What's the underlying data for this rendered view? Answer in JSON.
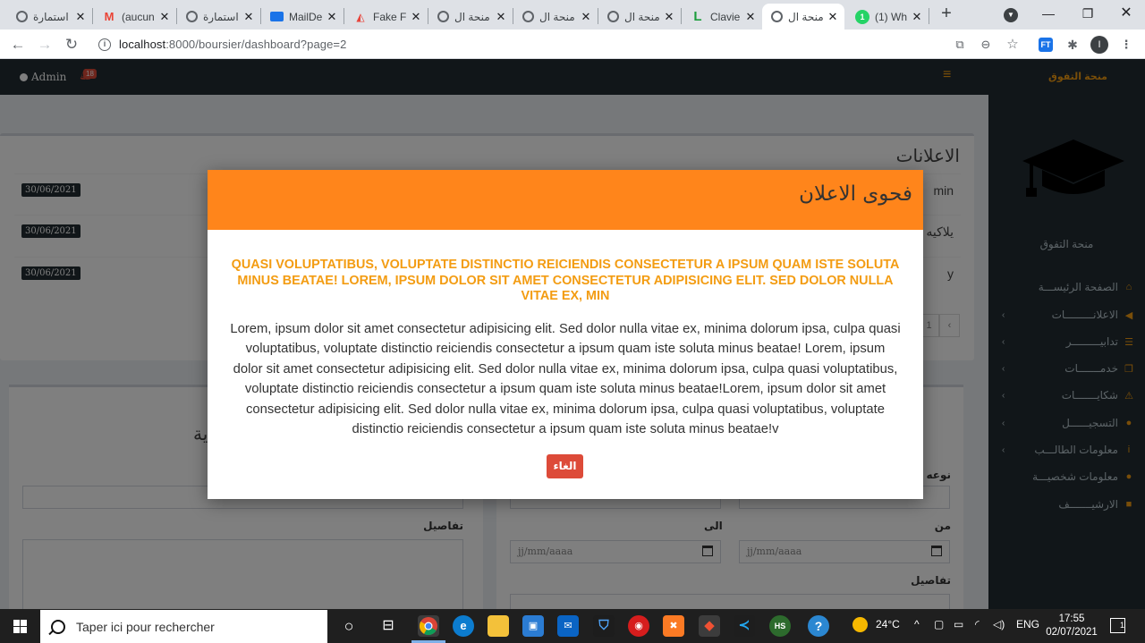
{
  "browser": {
    "tabs": [
      {
        "title": "استمارة",
        "favicon": "globe-icon"
      },
      {
        "title": "(aucun",
        "favicon": "gmail-icon"
      },
      {
        "title": "استمارة",
        "favicon": "globe-icon"
      },
      {
        "title": "MailDe",
        "favicon": "mail-icon"
      },
      {
        "title": "Fake Fi",
        "favicon": "fake-filler-icon"
      },
      {
        "title": "منحة ال",
        "favicon": "globe-icon"
      },
      {
        "title": "منحة ال",
        "favicon": "globe-icon"
      },
      {
        "title": "منحة ال",
        "favicon": "globe-icon"
      },
      {
        "title": "Clavier",
        "favicon": "l-icon"
      },
      {
        "title": "منحة ال",
        "favicon": "globe-icon"
      },
      {
        "title": "(1) Wh",
        "favicon": "whatsapp-icon"
      }
    ],
    "url_host": "localhost",
    "url_path": ":8000/boursier/dashboard?page=2",
    "profile_initial": "I",
    "extension_label": "FT"
  },
  "topnav": {
    "admin_label": "Admin",
    "notification_count": "18"
  },
  "sidebar": {
    "logo_text": "منحة التفوق",
    "brand": "منحة التفوق",
    "items": [
      {
        "label": "الصفحة الرئيســـة"
      },
      {
        "label": "الاعلانـــــــــات"
      },
      {
        "label": "تدابيـــــــــر"
      },
      {
        "label": "خدمـــــــات"
      },
      {
        "label": "شكايـــــــات"
      },
      {
        "label": "التسجيــــــل"
      },
      {
        "label": "معلومات الطالـــب"
      },
      {
        "label": "معلومات شخصيـــة"
      },
      {
        "label": "الارشيـــــــف"
      }
    ]
  },
  "announcements": {
    "title": "الاعلانات",
    "rows": [
      {
        "date": "30/06/2021",
        "text": "min"
      },
      {
        "date": "30/06/2021",
        "text": "يلاكيه"
      },
      {
        "date": "30/06/2021",
        "text": "y"
      }
    ],
    "pager": [
      "1",
      "‹"
    ]
  },
  "form_left": {
    "title": "ية",
    "details_label": "تفاصيل"
  },
  "form_right": {
    "type_label": "نوعه",
    "to_label": "الى",
    "from_label": "من",
    "date_placeholder": "jj/mm/aaaa",
    "details_label": "تفاصيل"
  },
  "modal": {
    "title": "فحوى الاعلان",
    "subtitle": "QUASI VOLUPTATIBUS, VOLUPTATE DISTINCTIO REICIENDIS CONSECTETUR A IPSUM QUAM ISTE SOLUTA MINUS BEATAE! LOREM, IPSUM DOLOR SIT AMET CONSECTETUR ADIPISICING ELIT. SED DOLOR NULLA VITAE EX, MIN",
    "body": "Lorem, ipsum dolor sit amet consectetur adipisicing elit. Sed dolor nulla vitae ex, minima dolorum ipsa, culpa quasi voluptatibus, voluptate distinctio reiciendis consectetur a ipsum quam iste soluta minus beatae! Lorem, ipsum dolor sit amet consectetur adipisicing elit. Sed dolor nulla vitae ex, minima dolorum ipsa, culpa quasi voluptatibus, voluptate distinctio reiciendis consectetur a ipsum quam iste soluta minus beatae!Lorem, ipsum dolor sit amet consectetur adipisicing elit. Sed dolor nulla vitae ex, minima dolorum ipsa, culpa quasi voluptatibus, voluptate distinctio reiciendis consectetur a ipsum quam iste soluta minus beatae!v",
    "cancel_label": "الغاء",
    "header_color": "#ff851b",
    "subtitle_color": "#f39c12",
    "cancel_color": "#dd4b39"
  },
  "taskbar": {
    "search_placeholder": "Taper ici pour rechercher",
    "weather": "24°C",
    "language": "ENG",
    "time": "17:55",
    "date": "02/07/2021",
    "notification_count": "1",
    "hs_label": "HS"
  }
}
